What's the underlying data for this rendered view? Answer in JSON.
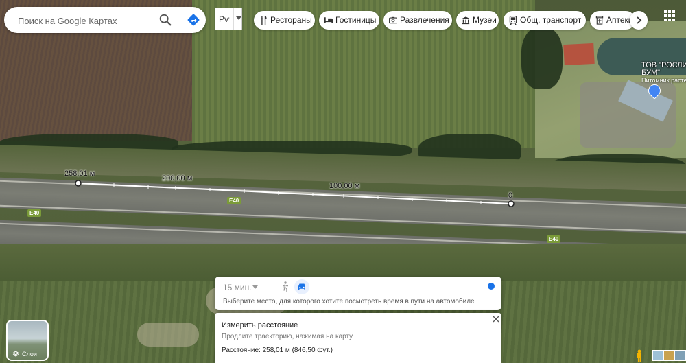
{
  "search": {
    "placeholder": "Поиск на Google Картах"
  },
  "language": {
    "label": "Рѵ"
  },
  "chips": [
    {
      "label": "Рестораны",
      "icon": "restaurant-icon"
    },
    {
      "label": "Гостиницы",
      "icon": "hotel-icon"
    },
    {
      "label": "Развлечения",
      "icon": "camera-icon"
    },
    {
      "label": "Музеи",
      "icon": "museum-icon"
    },
    {
      "label": "Общ. транспорт",
      "icon": "transit-icon"
    },
    {
      "label": "Аптеки",
      "icon": "pharmacy-icon"
    }
  ],
  "map": {
    "road_labels": [
      "E40",
      "E40",
      "E40"
    ],
    "distance_labels": [
      "258,01 м",
      "200,00 м",
      "100,00 м",
      "0"
    ],
    "poi": {
      "title_line1": "ТОВ \"РОСЛИ",
      "title_line2": "БУМ\"",
      "subtitle": "Питомник расте",
      "icon": "shop-icon"
    }
  },
  "travel_card": {
    "time": "15 мин.",
    "hint": "Выберите место, для которого хотите посмотреть время в пути на автомобиле",
    "modes": [
      "walk-icon",
      "car-icon"
    ]
  },
  "measure_card": {
    "title": "Измерить расстояние",
    "subtitle": "Продлите траекторию, нажимая на карту",
    "distance": "Расстояние: 258,01 м (846,50 фут.)"
  },
  "layers": {
    "label": "Слои"
  },
  "colors": {
    "accent": "#1a73e8",
    "road_shield": "#7b9b39",
    "roof_red": "#b5533f"
  }
}
